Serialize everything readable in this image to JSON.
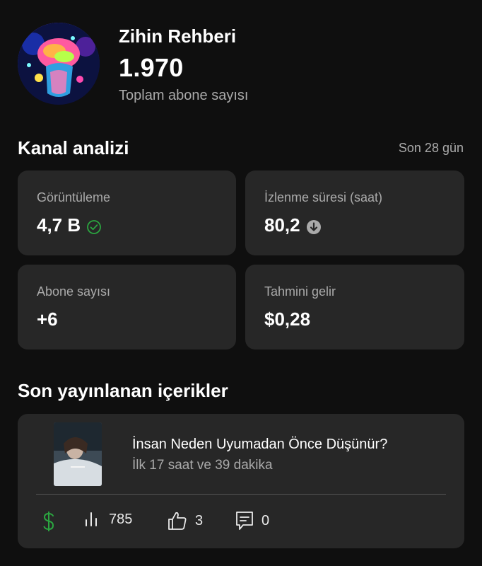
{
  "header": {
    "channel_name": "Zihin Rehberi",
    "subscriber_count": "1.970",
    "subscriber_label": "Toplam abone sayısı"
  },
  "analytics": {
    "title": "Kanal analizi",
    "period": "Son 28 gün",
    "cards": [
      {
        "label": "Görüntüleme",
        "value": "4,7 B",
        "icon": "check-circle-icon"
      },
      {
        "label": "İzlenme süresi (saat)",
        "value": "80,2",
        "icon": "arrow-down-circle-icon"
      },
      {
        "label": "Abone sayısı",
        "value": "+6"
      },
      {
        "label": "Tahmini gelir",
        "value": "$0,28"
      }
    ]
  },
  "recent": {
    "title": "Son yayınlanan içerikler",
    "video": {
      "title": "İnsan Neden Uyumadan Önce Düşünür?",
      "subtitle": "İlk 17 saat ve 39 dakika",
      "views": "785",
      "likes": "3",
      "comments": "0"
    }
  },
  "colors": {
    "background": "#0f0f0f",
    "card": "#272727",
    "secondary_text": "#aaaaaa",
    "success_green": "#2ba640"
  }
}
